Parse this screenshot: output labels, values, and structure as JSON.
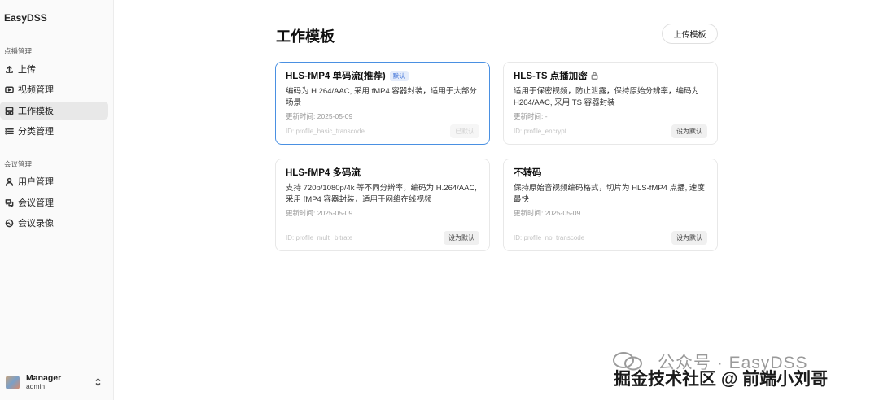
{
  "app": {
    "brand": "EasyDSS"
  },
  "sidebar": {
    "groups": [
      {
        "title": "点播管理"
      },
      {
        "title": "会议管理"
      }
    ],
    "items": [
      {
        "label": "上传",
        "icon": "upload-icon"
      },
      {
        "label": "视频管理",
        "icon": "video-icon"
      },
      {
        "label": "工作模板",
        "icon": "template-icon",
        "active": true
      },
      {
        "label": "分类管理",
        "icon": "list-icon"
      },
      {
        "label": "用户管理",
        "icon": "user-icon"
      },
      {
        "label": "会议管理",
        "icon": "meeting-icon"
      },
      {
        "label": "会议录像",
        "icon": "record-icon"
      }
    ],
    "user": {
      "name": "Manager",
      "role": "admin"
    }
  },
  "main": {
    "title": "工作模板",
    "upload_button": "上传模板",
    "cards": [
      {
        "title": "HLS-fMP4 单码流(推荐)",
        "badge": "默认",
        "desc": "编码为 H.264/AAC, 采用 fMP4 容器封装，适用于大部分场景",
        "date": "更新时间: 2025-05-09",
        "id": "ID: profile_basic_transcode",
        "action": "已默认"
      },
      {
        "title": "HLS-TS 点播加密",
        "desc": "适用于保密视频，防止泄露，保持原始分辨率，编码为 H264/AAC, 采用 TS 容器封装",
        "date": "更新时间: -",
        "id": "ID: profile_encrypt",
        "action": "设为默认"
      },
      {
        "title": "HLS-fMP4 多码流",
        "desc": "支持 720p/1080p/4k 等不同分辨率，编码为 H.264/AAC, 采用 fMP4 容器封装，适用于网络在线视频",
        "date": "更新时间: 2025-05-09",
        "id": "ID: profile_multi_bitrate",
        "action": "设为默认"
      },
      {
        "title": "不转码",
        "desc": "保持原始音视频编码格式，切片为 HLS-fMP4 点播, 速度最快",
        "date": "更新时间: 2025-05-09",
        "id": "ID: profile_no_transcode",
        "action": "设为默认"
      }
    ]
  },
  "watermark": {
    "line1": "公众号 · EasyDSS",
    "line2": "掘金技术社区 @ 前端小刘哥"
  },
  "colors": {
    "accent": "#4a90e2",
    "badge_bg": "#e4ecfb",
    "active_bg": "#e8e8e8"
  }
}
